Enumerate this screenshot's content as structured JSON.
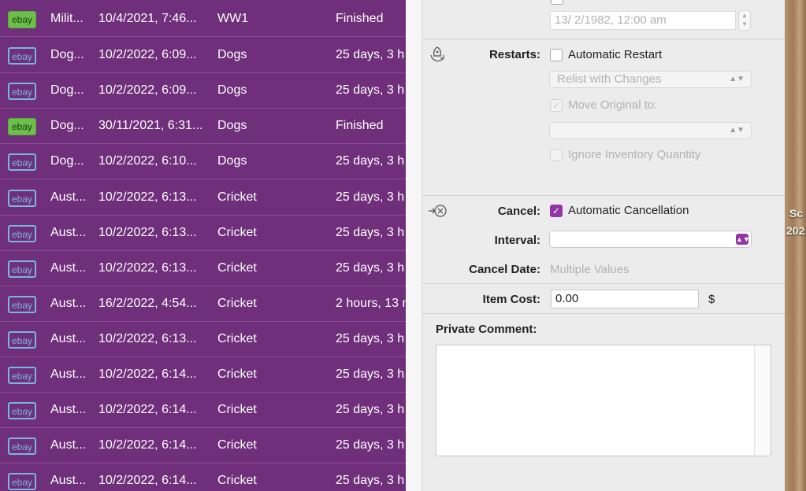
{
  "list": {
    "rows": [
      {
        "badge": "ebay",
        "state": "finished",
        "title": "Milit...",
        "date": "10/4/2021, 7:46...",
        "category": "WW1",
        "status": "Finished"
      },
      {
        "badge": "ebay",
        "state": "active",
        "title": "Dog...",
        "date": "10/2/2022, 6:09...",
        "category": "Dogs",
        "status": "25 days, 3 h"
      },
      {
        "badge": "ebay",
        "state": "active",
        "title": "Dog...",
        "date": "10/2/2022, 6:09...",
        "category": "Dogs",
        "status": "25 days, 3 h"
      },
      {
        "badge": "ebay",
        "state": "finished",
        "title": "Dog...",
        "date": "30/11/2021, 6:31...",
        "category": "Dogs",
        "status": "Finished"
      },
      {
        "badge": "ebay",
        "state": "active",
        "title": "Dog...",
        "date": "10/2/2022, 6:10...",
        "category": "Dogs",
        "status": "25 days, 3 h"
      },
      {
        "badge": "ebay",
        "state": "active",
        "title": "Aust...",
        "date": "10/2/2022, 6:13...",
        "category": "Cricket",
        "status": "25 days, 3 h"
      },
      {
        "badge": "ebay",
        "state": "active",
        "title": "Aust...",
        "date": "10/2/2022, 6:13...",
        "category": "Cricket",
        "status": "25 days, 3 h"
      },
      {
        "badge": "ebay",
        "state": "active",
        "title": "Aust...",
        "date": "10/2/2022, 6:13...",
        "category": "Cricket",
        "status": "25 days, 3 h"
      },
      {
        "badge": "ebay",
        "state": "active",
        "title": "Aust...",
        "date": "16/2/2022, 4:54...",
        "category": "Cricket",
        "status": "2 hours, 13 n"
      },
      {
        "badge": "ebay",
        "state": "active",
        "title": "Aust...",
        "date": "10/2/2022, 6:13...",
        "category": "Cricket",
        "status": "25 days, 3 h"
      },
      {
        "badge": "ebay",
        "state": "active",
        "title": "Aust...",
        "date": "10/2/2022, 6:14...",
        "category": "Cricket",
        "status": "25 days, 3 h"
      },
      {
        "badge": "ebay",
        "state": "active",
        "title": "Aust...",
        "date": "10/2/2022, 6:14...",
        "category": "Cricket",
        "status": "25 days, 3 h"
      },
      {
        "badge": "ebay",
        "state": "active",
        "title": "Aust...",
        "date": "10/2/2022, 6:14...",
        "category": "Cricket",
        "status": "25 days, 3 h"
      },
      {
        "badge": "ebay",
        "state": "active",
        "title": "Aust...",
        "date": "10/2/2022, 6:14...",
        "category": "Cricket",
        "status": "25 days, 3 h"
      }
    ]
  },
  "panel": {
    "schedule": {
      "date_value": "13/  2/1982, 12:00 am"
    },
    "restarts": {
      "label": "Restarts:",
      "auto_restart_label": "Automatic Restart",
      "relist_option": "Relist with Changes",
      "move_original_label": "Move Original to:",
      "move_original_value": "",
      "ignore_inventory_label": "Ignore Inventory Quantity"
    },
    "cancel": {
      "label": "Cancel:",
      "auto_cancel_label": "Automatic Cancellation",
      "interval_label": "Interval:",
      "interval_value": "",
      "cancel_date_label": "Cancel Date:",
      "cancel_date_value": "Multiple Values"
    },
    "item_cost": {
      "label": "Item Cost:",
      "value": "0.00",
      "currency": "$"
    },
    "private_comment": {
      "label": "Private Comment:",
      "value": ""
    }
  },
  "background_edge": {
    "line1": "Sc",
    "line2": "202"
  },
  "colors": {
    "list_bg": "#6f2f7a",
    "accent": "#9335a4",
    "finished_badge": "#6cc04a",
    "active_badge": "#78b6e4"
  }
}
